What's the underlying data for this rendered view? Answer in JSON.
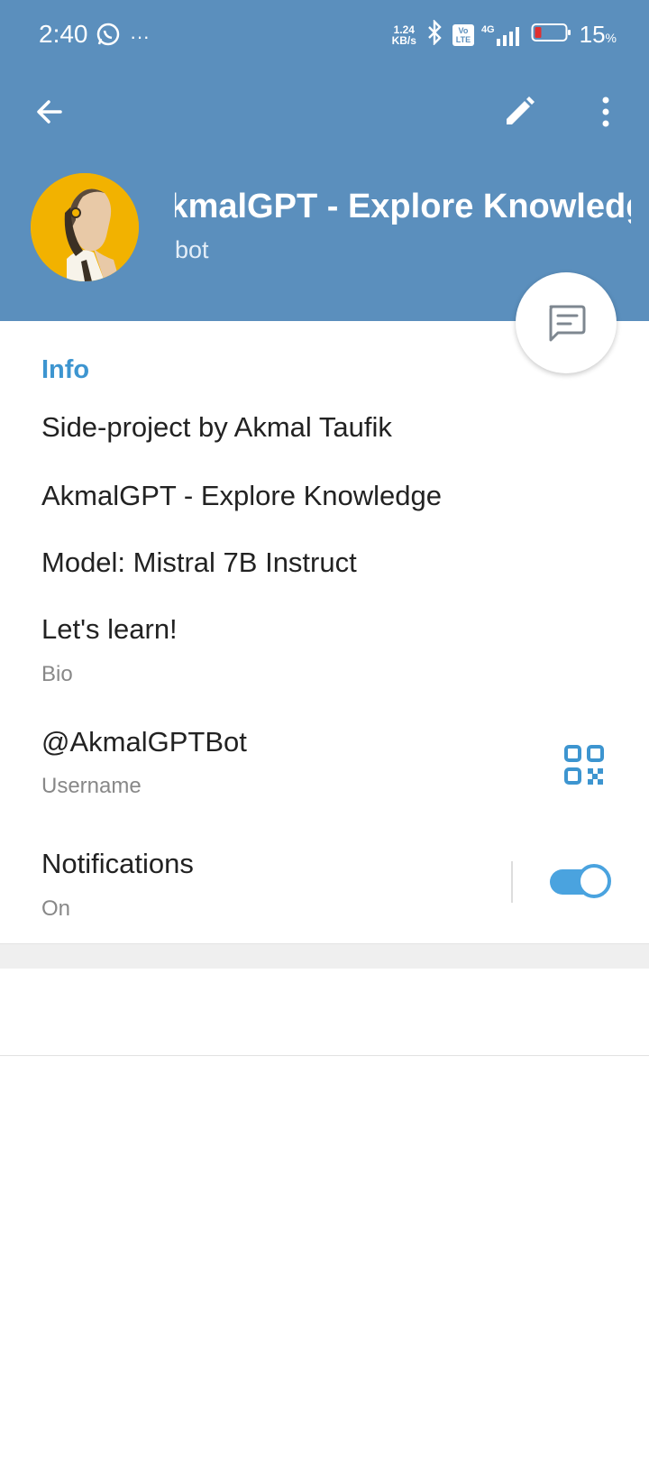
{
  "status_bar": {
    "time": "2:40",
    "dots": "···",
    "speed_value": "1.24",
    "speed_unit": "KB/s",
    "network": "4G",
    "volte": "Vo LTE",
    "battery_percent": "15",
    "battery_unit": "%"
  },
  "header": {
    "title": "AkmalGPT - Explore Knowledge   AkmalGPT - Explore Knowledge",
    "subtitle": "bot"
  },
  "info": {
    "section_title": "Info",
    "lines": [
      "Side-project by Akmal Taufik",
      "AkmalGPT - Explore Knowledge",
      "Model: Mistral 7B Instruct",
      "Let's learn!"
    ],
    "bio_label": "Bio",
    "username": "@AkmalGPTBot",
    "username_label": "Username",
    "notifications": "Notifications",
    "notifications_state": "On"
  },
  "colors": {
    "header": "#5b8fbd",
    "accent": "#3d95d0",
    "toggle": "#4aa3df"
  }
}
